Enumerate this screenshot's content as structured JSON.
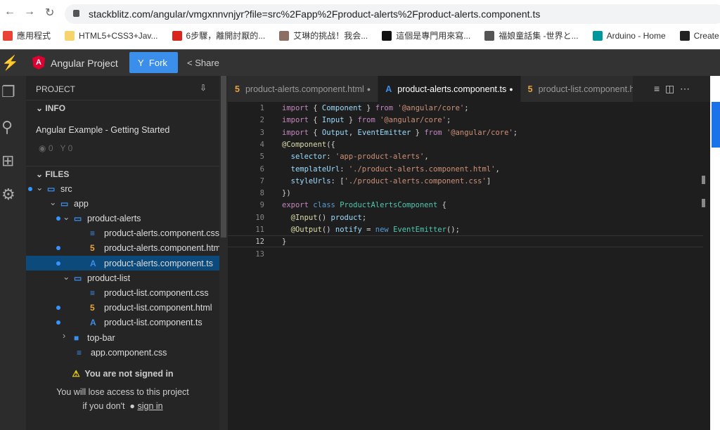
{
  "browser": {
    "url": "stackblitz.com/angular/vmgxnnvnjyr?file=src%2Fapp%2Fproduct-alerts%2Fproduct-alerts.component.ts",
    "bookmarks": [
      {
        "label": "應用程式",
        "color": "#ea4335"
      },
      {
        "label": "HTML5+CSS3+Jav...",
        "color": "#f6d46b"
      },
      {
        "label": "6步驟，離開討厭的...",
        "color": "#d9261c"
      },
      {
        "label": "艾琳的挑战！我会...",
        "color": "#8d6e63"
      },
      {
        "label": "這個是專門用來寫...",
        "color": "#111111"
      },
      {
        "label": "福娘童話集 -世界と...",
        "color": "#555555"
      },
      {
        "label": "Arduino - Home",
        "color": "#00979c"
      },
      {
        "label": "Create a",
        "color": "#222222"
      }
    ]
  },
  "app": {
    "title": "Angular Project",
    "fork": "Fork",
    "share": "Share",
    "accent": "#3b8eea"
  },
  "sidebar": {
    "project": "PROJECT",
    "info": "INFO",
    "project_name": "Angular Example - Getting Started",
    "views": "0",
    "forks": "0",
    "files": "FILES",
    "tree": [
      {
        "label": "src",
        "type": "folder",
        "depth": 0,
        "open": true,
        "dot": true
      },
      {
        "label": "app",
        "type": "folder",
        "depth": 1,
        "open": true
      },
      {
        "label": "product-alerts",
        "type": "folder",
        "depth": 2,
        "open": true,
        "dot": true
      },
      {
        "label": "product-alerts.component.css",
        "type": "css",
        "depth": 3
      },
      {
        "label": "product-alerts.component.html",
        "type": "html",
        "depth": 3,
        "dot": true
      },
      {
        "label": "product-alerts.component.ts",
        "type": "ts",
        "depth": 3,
        "dot": true,
        "selected": true
      },
      {
        "label": "product-list",
        "type": "folder",
        "depth": 2,
        "open": true
      },
      {
        "label": "product-list.component.css",
        "type": "css",
        "depth": 3
      },
      {
        "label": "product-list.component.html",
        "type": "html",
        "depth": 3,
        "dot": true
      },
      {
        "label": "product-list.component.ts",
        "type": "ts",
        "depth": 3,
        "dot": true
      },
      {
        "label": "top-bar",
        "type": "folder-closed",
        "depth": 2
      },
      {
        "label": "app.component.css",
        "type": "css",
        "depth": 2
      }
    ],
    "warning_title": "You are not signed in",
    "warning_line1": "You will lose access to this project",
    "warning_line2": "if you don't",
    "sign_in": "sign in"
  },
  "tabs": [
    {
      "label": "product-alerts.component.html",
      "icon": "html5",
      "active": false
    },
    {
      "label": "product-alerts.component.ts",
      "icon": "angular",
      "active": true
    },
    {
      "label": "product-list.component.ht",
      "icon": "html5",
      "active": false
    }
  ],
  "code": [
    [
      [
        "import",
        "kw"
      ],
      [
        " { ",
        "p"
      ],
      [
        "Component",
        "id"
      ],
      [
        " } ",
        "p"
      ],
      [
        "from",
        "kw"
      ],
      [
        " ",
        "p"
      ],
      [
        "'@angular/core'",
        "str"
      ],
      [
        ";",
        "p"
      ]
    ],
    [
      [
        "import",
        "kw"
      ],
      [
        " { ",
        "p"
      ],
      [
        "Input",
        "id"
      ],
      [
        " } ",
        "p"
      ],
      [
        "from",
        "kw"
      ],
      [
        " ",
        "p"
      ],
      [
        "'@angular/core'",
        "str"
      ],
      [
        ";",
        "p"
      ]
    ],
    [
      [
        "import",
        "kw"
      ],
      [
        " { ",
        "p"
      ],
      [
        "Output",
        "id"
      ],
      [
        ", ",
        "p"
      ],
      [
        "EventEmitter",
        "id"
      ],
      [
        " } ",
        "p"
      ],
      [
        "from",
        "kw"
      ],
      [
        " ",
        "p"
      ],
      [
        "'@angular/core'",
        "str"
      ],
      [
        ";",
        "p"
      ]
    ],
    [
      [
        "@Component",
        "dec"
      ],
      [
        "({",
        "p"
      ]
    ],
    [
      [
        "  selector",
        "id"
      ],
      [
        ": ",
        "p"
      ],
      [
        "'app-product-alerts'",
        "str"
      ],
      [
        ",",
        "p"
      ]
    ],
    [
      [
        "  templateUrl",
        "id"
      ],
      [
        ": ",
        "p"
      ],
      [
        "'./product-alerts.component.html'",
        "str"
      ],
      [
        ",",
        "p"
      ]
    ],
    [
      [
        "  styleUrls",
        "id"
      ],
      [
        ": [",
        "p"
      ],
      [
        "'./product-alerts.component.css'",
        "str"
      ],
      [
        "]",
        "p"
      ]
    ],
    [
      [
        "})",
        "p"
      ]
    ],
    [
      [
        "export",
        "kw"
      ],
      [
        " ",
        "p"
      ],
      [
        "class",
        "nw"
      ],
      [
        " ",
        "p"
      ],
      [
        "ProductAlertsComponent",
        "cls"
      ],
      [
        " {",
        "p"
      ]
    ],
    [
      [
        "  @Input",
        "dec"
      ],
      [
        "() ",
        "p"
      ],
      [
        "product",
        "id"
      ],
      [
        ";",
        "p"
      ]
    ],
    [
      [
        "  @Output",
        "dec"
      ],
      [
        "() ",
        "p"
      ],
      [
        "notify",
        "id"
      ],
      [
        " = ",
        "p"
      ],
      [
        "new",
        "nw"
      ],
      [
        " ",
        "p"
      ],
      [
        "EventEmitter",
        "cls"
      ],
      [
        "();",
        "p"
      ]
    ],
    [
      [
        "}",
        "p"
      ]
    ],
    []
  ]
}
